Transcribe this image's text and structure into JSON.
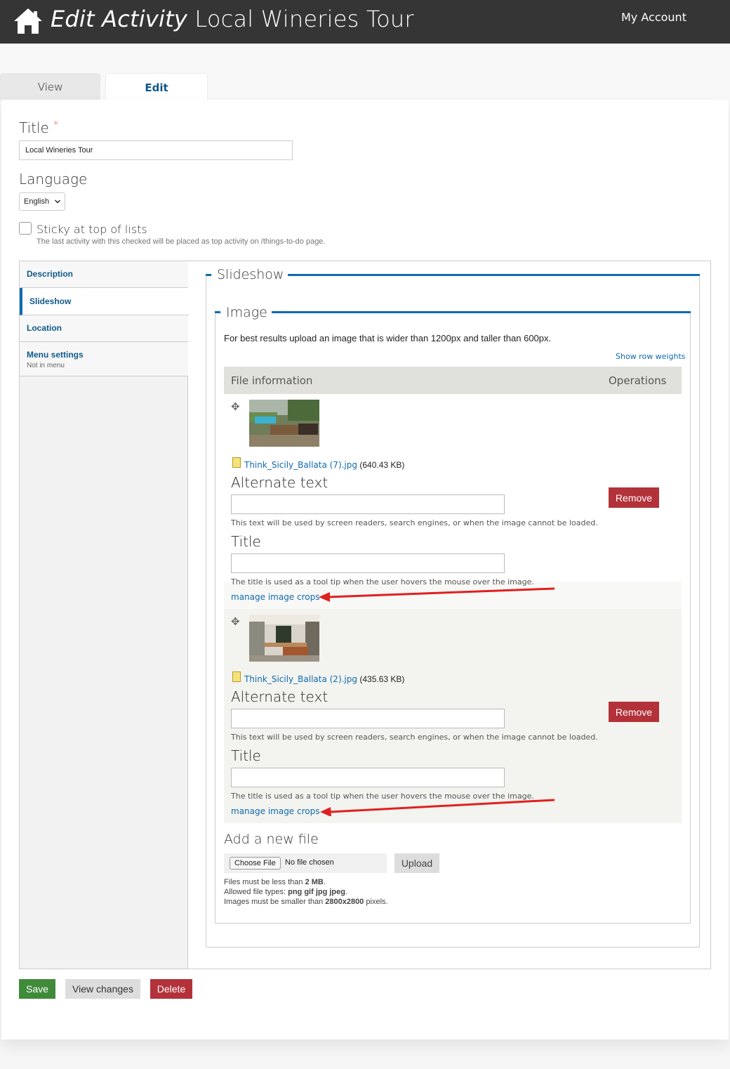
{
  "header": {
    "title_prefix": "Edit Activity",
    "title_name": "Local Wineries Tour",
    "account_link": "My Account",
    "home_icon": "home-icon"
  },
  "tabs": [
    {
      "label": "View",
      "active": false
    },
    {
      "label": "Edit",
      "active": true
    }
  ],
  "form": {
    "title_label": "Title",
    "required_mark": "*",
    "title_value": "Local Wineries Tour",
    "language_label": "Language",
    "language_value": "English",
    "sticky_label": "Sticky at top of lists",
    "sticky_checked": false,
    "sticky_desc": "The last activity with this checked will be placed as top activity on /things-to-do page."
  },
  "vertical_tabs": [
    {
      "label": "Description",
      "summary": ""
    },
    {
      "label": "Slideshow",
      "summary": "",
      "active": true
    },
    {
      "label": "Location",
      "summary": ""
    },
    {
      "label": "Menu settings",
      "summary": "Not in menu"
    }
  ],
  "slideshow": {
    "legend": "Slideshow",
    "image_legend": "Image",
    "help_text": "For best results upload an image that is wider than 1200px and taller than 600px.",
    "row_weights_link": "Show row weights",
    "table_headers": [
      "File information",
      "Operations"
    ],
    "files": [
      {
        "name": "Think_Sicily_Ballata (7).jpg",
        "size": "(640.43 KB)",
        "alt_label": "Alternate text",
        "alt_value": "",
        "alt_desc": "This text will be used by screen readers, search engines, or when the image cannot be loaded.",
        "title_label": "Title",
        "title_value": "",
        "title_desc": "The title is used as a tool tip when the user hovers the mouse over the image.",
        "crop_link": "manage image crops",
        "remove_label": "Remove"
      },
      {
        "name": "Think_Sicily_Ballata (2).jpg",
        "size": "(435.63 KB)",
        "alt_label": "Alternate text",
        "alt_value": "",
        "alt_desc": "This text will be used by screen readers, search engines, or when the image cannot be loaded.",
        "title_label": "Title",
        "title_value": "",
        "title_desc": "The title is used as a tool tip when the user hovers the mouse over the image.",
        "crop_link": "manage image crops",
        "remove_label": "Remove"
      }
    ],
    "add_new_label": "Add a new file",
    "choose_file_label": "Choose File",
    "no_file_text": "No file chosen",
    "upload_label": "Upload",
    "limits": {
      "size_prefix": "Files must be less than ",
      "size_value": "2 MB",
      "size_suffix": ".",
      "types_prefix": "Allowed file types: ",
      "types_value": "png gif jpg jpeg",
      "types_suffix": ".",
      "dims_prefix": "Images must be smaller than ",
      "dims_value": "2800x2800",
      "dims_suffix": " pixels."
    }
  },
  "actions": {
    "save": "Save",
    "view_changes": "View changes",
    "delete": "Delete"
  },
  "colors": {
    "header_bg": "#353535",
    "link": "#0e6bb0",
    "accent_blue": "#0e6bb0",
    "save_green": "#3f8b3a",
    "danger_red": "#b3323a",
    "annotation_arrow": "#e02020"
  }
}
